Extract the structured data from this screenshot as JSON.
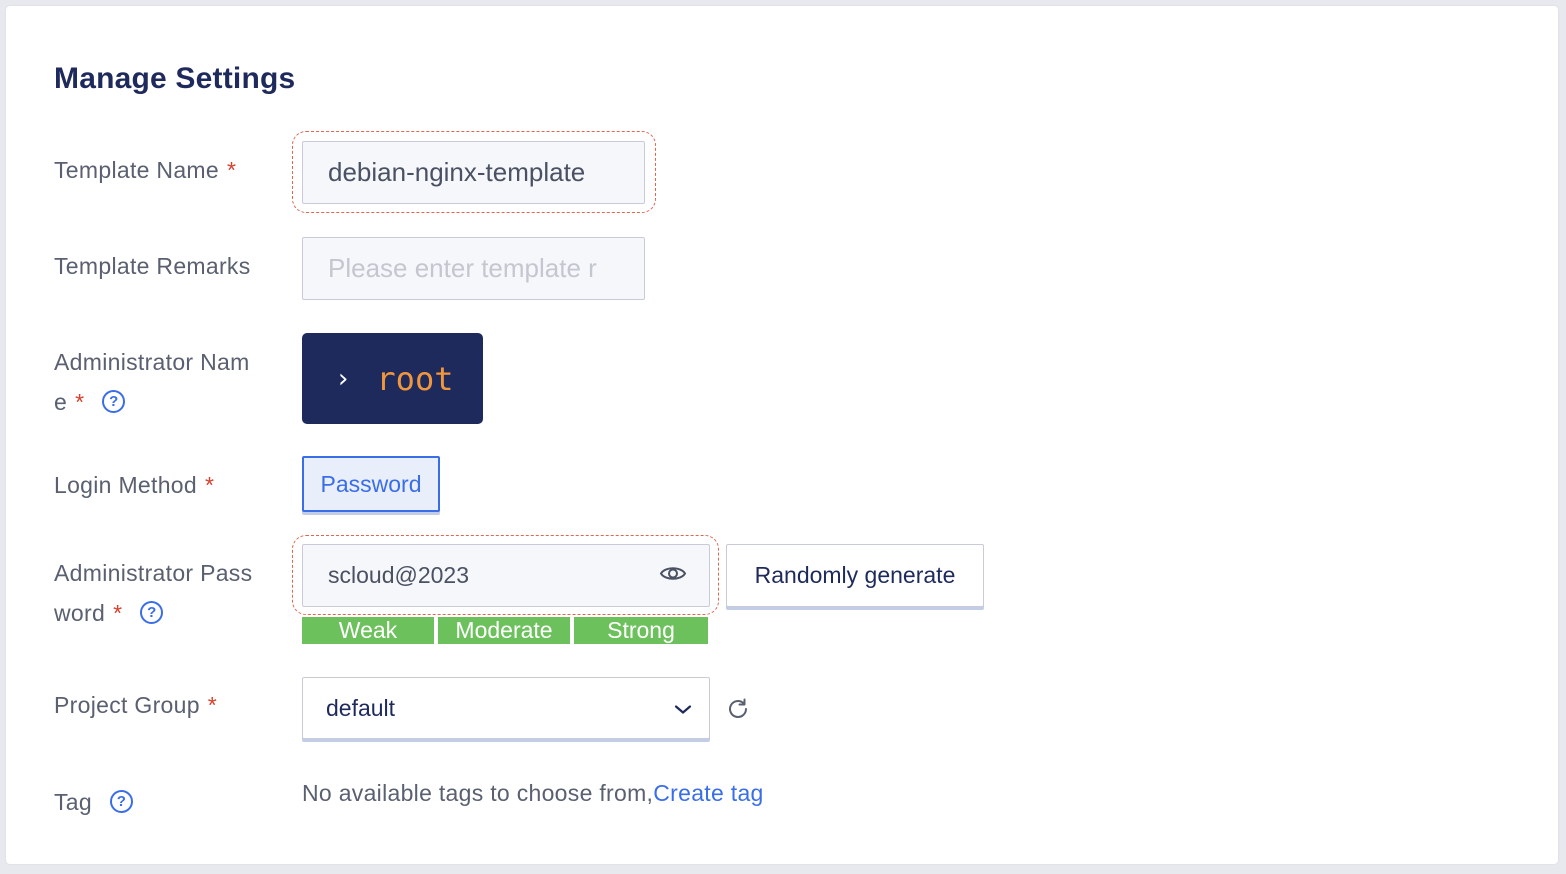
{
  "title": "Manage Settings",
  "fields": {
    "template_name": {
      "label": "Template Name",
      "required": "*",
      "value": "debian-nginx-template"
    },
    "template_remarks": {
      "label": "Template Remarks",
      "placeholder": "Please enter template r"
    },
    "admin_name": {
      "label_line1": "Administrator Nam",
      "label_line2": "e",
      "required": "*",
      "help": "?",
      "prompt": "›",
      "value": "root"
    },
    "login_method": {
      "label": "Login Method",
      "required": "*",
      "option": "Password"
    },
    "admin_password": {
      "label_line1": "Administrator Pass",
      "label_line2": "word",
      "required": "*",
      "help": "?",
      "value": "scloud@2023",
      "generate_button": "Randomly generate",
      "strength": [
        "Weak",
        "Moderate",
        "Strong"
      ]
    },
    "project_group": {
      "label": "Project Group",
      "required": "*",
      "value": "default"
    },
    "tag": {
      "label": "Tag",
      "help": "?",
      "empty_text": "No available tags to choose from,",
      "create_link": "Create tag"
    }
  },
  "colors": {
    "accent": "#3a6ee8",
    "title": "#1f2a5c",
    "required": "#d8402e",
    "terminal_bg": "#1f2a5c",
    "terminal_user": "#f0963c",
    "strength_bar": "#6cc15c"
  },
  "icons": {
    "password_toggle": "eye-icon",
    "select_arrow": "chevron-down-icon",
    "refresh": "refresh-icon",
    "help": "question-circle-icon"
  }
}
